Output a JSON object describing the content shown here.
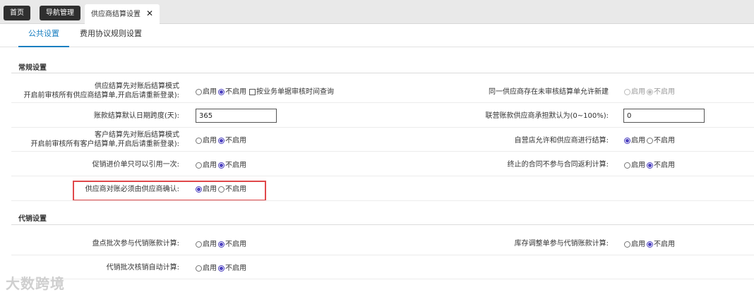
{
  "tabs": [
    {
      "label": "首页"
    },
    {
      "label": "导航管理"
    },
    {
      "label": "供应商结算设置",
      "close": "✕"
    }
  ],
  "subtabs": [
    {
      "label": "公共设置"
    },
    {
      "label": "费用协议规则设置"
    }
  ],
  "sections": {
    "general": "常规设置",
    "consignment": "代销设置"
  },
  "options": {
    "enable": "启用",
    "disable": "不启用",
    "by_audit_time": "按业务单据审核时间查询"
  },
  "rows": {
    "supplier_settle_mode": {
      "line1": "供应结算先对账后结算模式",
      "line2": "开启前审核所有供应商结算单,开启后请重新登录):"
    },
    "same_supplier_unaudited": {
      "label": "同一供应商存在未审核结算单允许新建"
    },
    "default_date_span": {
      "label": "账款结算默认日期跨度(天):",
      "value": "365"
    },
    "joint_default_ratio": {
      "label": "联营账款供应商承担默认为(0~100%):",
      "value": "0"
    },
    "customer_settle_mode": {
      "line1": "客户结算先对账后结算模式",
      "line2": "开启前审核所有客户结算单,开启后请重新登录):"
    },
    "self_store_settle": {
      "label": "自营店允许和供应商进行结算:"
    },
    "promo_price_once": {
      "label": "促销进价单只可以引用一次:"
    },
    "terminated_contract": {
      "label": "终止的合同不参与合同返利计算:"
    },
    "supplier_confirm": {
      "label": "供应商对账必须由供应商确认:"
    },
    "inventory_batch": {
      "label": "盘点批次参与代销账款计算:"
    },
    "stock_adjust": {
      "label": "库存调整单参与代销账款计算:"
    },
    "consign_batch_auto": {
      "label": "代销批次核销自动计算:"
    }
  },
  "watermark": "大数跨境"
}
